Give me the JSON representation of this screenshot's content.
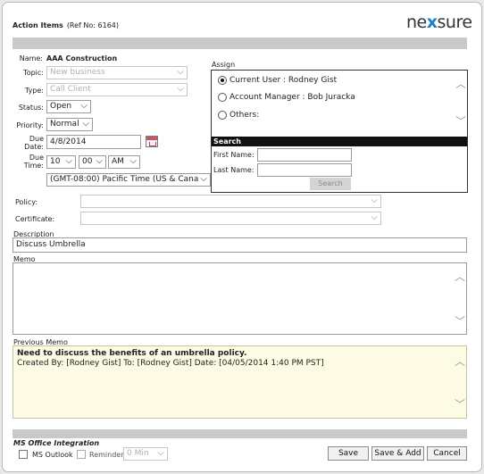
{
  "header": {
    "title": "Action Items",
    "ref": "(Ref No: 6164)",
    "logo_prefix": "ne",
    "logo_x": "x",
    "logo_suffix": "sure"
  },
  "form": {
    "name_label": "Name:",
    "name_value": "AAA Construction",
    "topic_label": "Topic:",
    "topic_value": "New business",
    "type_label": "Type:",
    "type_value": "Call Client",
    "status_label": "Status:",
    "status_value": "Open",
    "priority_label": "Priority:",
    "priority_value": "Normal",
    "due_date_label_1": "Due",
    "due_date_label_2": "Date:",
    "due_date_value": "4/8/2014",
    "due_time_label_1": "Due",
    "due_time_label_2": "Time:",
    "hour": "10",
    "minute": "00",
    "ampm": "AM",
    "timezone": "(GMT-08:00) Pacific Time (US & Cana",
    "policy_label": "Policy:",
    "certificate_label": "Certificate:",
    "description_label": "Description",
    "description_value": "Discuss Umbrella",
    "memo_label": "Memo"
  },
  "assign": {
    "label": "Assign",
    "options": [
      {
        "label": "Current User : Rodney Gist",
        "selected": true
      },
      {
        "label": "Account Manager : Bob Juracka",
        "selected": false
      },
      {
        "label": "Others:",
        "selected": false
      }
    ],
    "search_header": "Search",
    "first_name_label": "First Name:",
    "last_name_label": "Last Name:",
    "search_button": "Search"
  },
  "previous_memo": {
    "label": "Previous Memo",
    "line1": "Need to discuss the benefits of an umbrella policy.",
    "line2": "Created By: [Rodney Gist] To: [Rodney Gist] Date: [04/05/2014 1:40 PM PST]"
  },
  "footer": {
    "ms_office_label": "MS Office Integration",
    "outlook_label": "MS Outlook",
    "reminder_label": "Reminder",
    "reminder_value": "0 Min",
    "save": "Save",
    "save_add": "Save & Add",
    "cancel": "Cancel"
  },
  "colors": {
    "logo_accent": "#1e7fc9",
    "previous_memo_bg": "#fdfbe3",
    "section_bar": "#c9c9c9"
  }
}
